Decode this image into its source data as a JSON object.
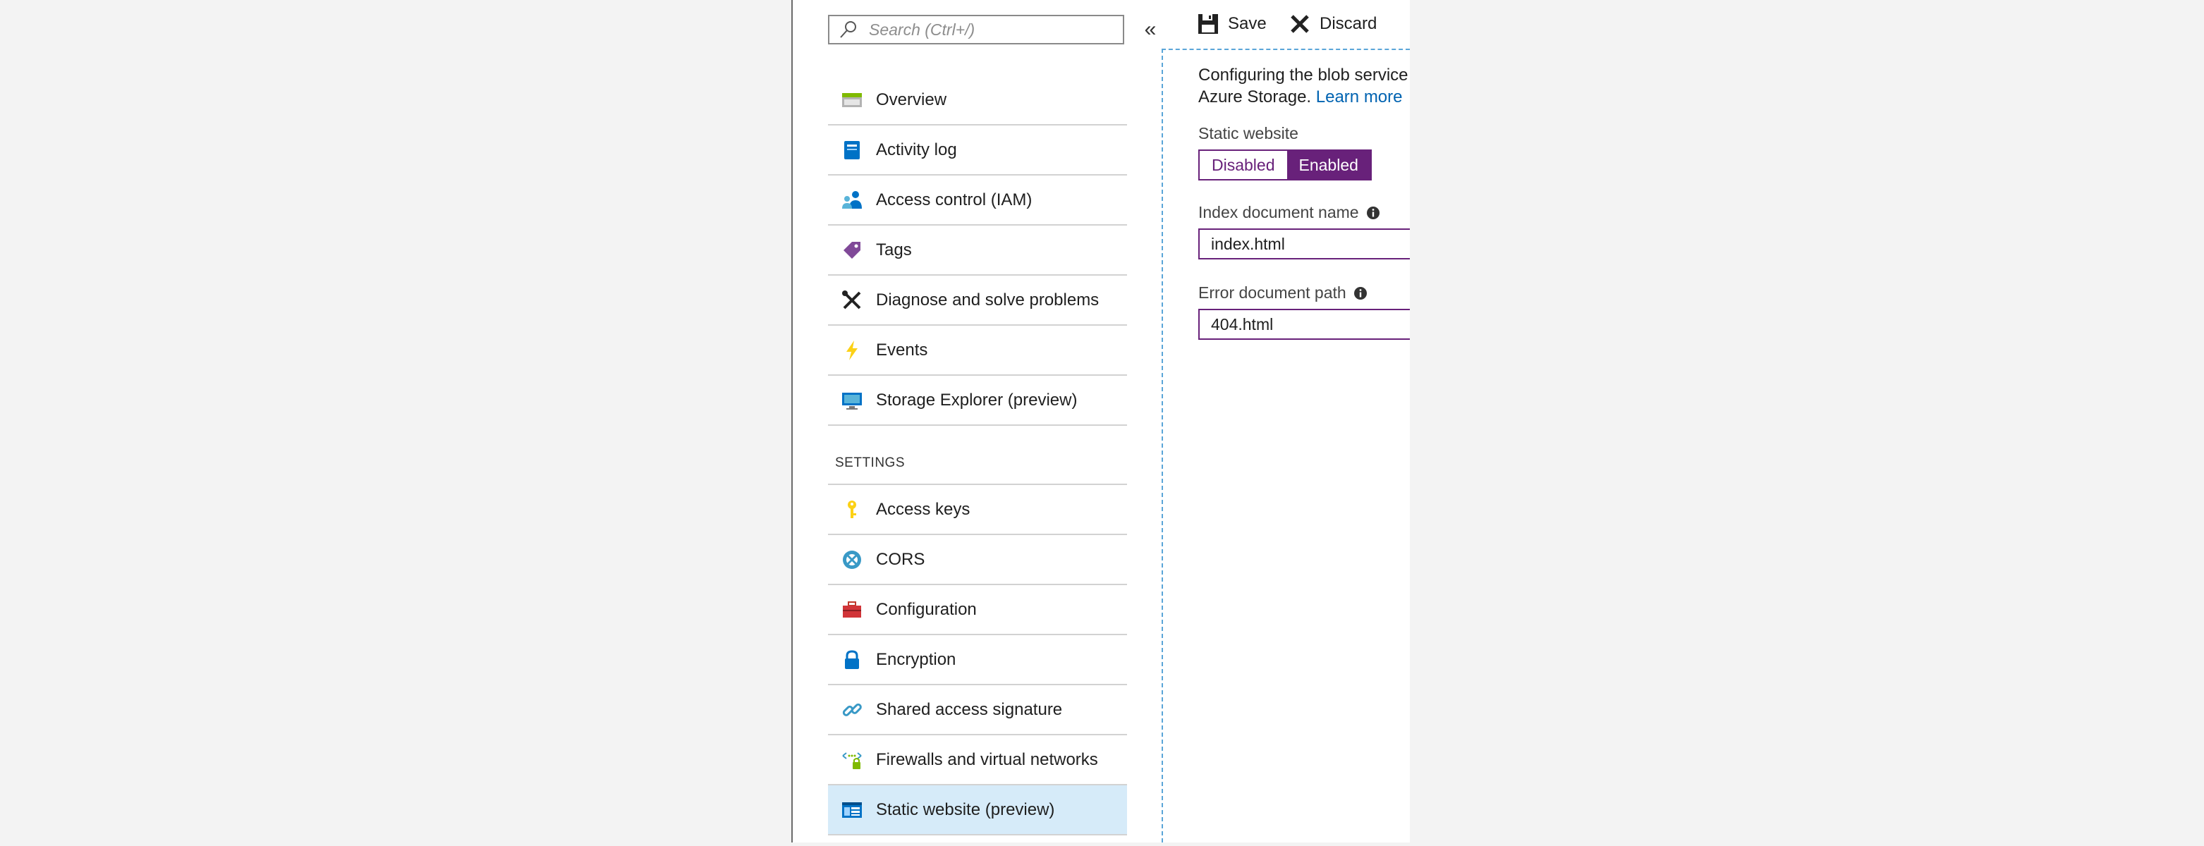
{
  "search": {
    "placeholder": "Search (Ctrl+/)"
  },
  "nav": {
    "collapse_glyph": "«",
    "items": [
      {
        "label": "Overview",
        "icon": "overview-icon"
      },
      {
        "label": "Activity log",
        "icon": "activity-log-icon"
      },
      {
        "label": "Access control (IAM)",
        "icon": "iam-icon"
      },
      {
        "label": "Tags",
        "icon": "tag-icon"
      },
      {
        "label": "Diagnose and solve problems",
        "icon": "tools-icon"
      },
      {
        "label": "Events",
        "icon": "lightning-icon"
      },
      {
        "label": "Storage Explorer (preview)",
        "icon": "storage-explorer-icon"
      }
    ],
    "settings_label": "SETTINGS",
    "settings_items": [
      {
        "label": "Access keys",
        "icon": "key-icon"
      },
      {
        "label": "CORS",
        "icon": "cors-icon"
      },
      {
        "label": "Configuration",
        "icon": "toolbox-icon"
      },
      {
        "label": "Encryption",
        "icon": "lock-icon"
      },
      {
        "label": "Shared access signature",
        "icon": "link-icon"
      },
      {
        "label": "Firewalls and virtual networks",
        "icon": "network-icon"
      },
      {
        "label": "Static website (preview)",
        "icon": "website-icon",
        "active": true
      }
    ]
  },
  "toolbar": {
    "save_label": "Save",
    "discard_label": "Discard"
  },
  "blade": {
    "description_line1": "Configuring the blob service",
    "description_line2": "Azure Storage.",
    "learn_more": "Learn more",
    "static_website_label": "Static website",
    "toggle": {
      "disabled": "Disabled",
      "enabled": "Enabled",
      "selected": "Enabled"
    },
    "index_label": "Index document name",
    "index_value": "index.html",
    "error_label": "Error document path",
    "error_value": "404.html"
  },
  "colors": {
    "accent": "#68217a",
    "link": "#0063b1",
    "active_bg": "#d6ebf9",
    "focus_dash": "#5aa5d8"
  }
}
